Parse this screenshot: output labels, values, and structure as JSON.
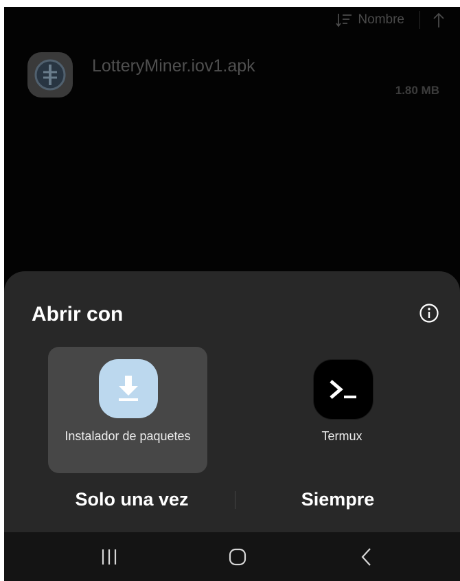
{
  "file_list": {
    "sort_label": "Nombre",
    "icons": {
      "sort": "sort-icon",
      "sort_direction": "arrow-up-icon"
    },
    "files": [
      {
        "name": "LotteryMiner.iov1.apk",
        "size": "1.80 MB",
        "icon": "apk-file-icon"
      }
    ]
  },
  "sheet": {
    "title": "Abrir con",
    "info_icon": "info-icon",
    "apps": [
      {
        "label": "Instalador de paquetes",
        "icon": "download-icon",
        "selected": true
      },
      {
        "label": "Termux",
        "icon": "terminal-icon",
        "selected": false
      }
    ],
    "actions": {
      "once": "Solo una vez",
      "always": "Siempre"
    }
  },
  "nav_bar": {
    "icons": [
      "recents-icon",
      "home-icon",
      "back-icon"
    ]
  },
  "colors": {
    "background": "#030303",
    "sheet": "#282828",
    "selected_tile": "#474747",
    "installer_icon_bg": "#bcd8ee",
    "installer_icon_fg": "#ffffff",
    "text_primary": "#ffffff",
    "text_dimmed": "#4f4f4f",
    "nav_bar": "#141414"
  }
}
